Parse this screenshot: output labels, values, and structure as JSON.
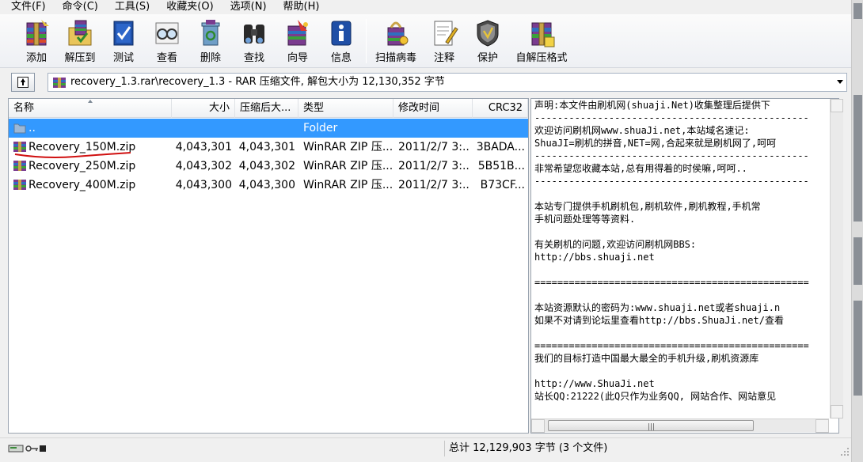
{
  "menu": [
    "文件(F)",
    "命令(C)",
    "工具(S)",
    "收藏夹(O)",
    "选项(N)",
    "帮助(H)"
  ],
  "toolbar": {
    "add": "添加",
    "extract_to": "解压到",
    "test": "测试",
    "view": "查看",
    "delete": "删除",
    "find": "查找",
    "wizard": "向导",
    "info": "信息",
    "virus_scan": "扫描病毒",
    "comment": "注释",
    "protect": "保护",
    "sfx": "自解压格式"
  },
  "address": {
    "path": "recovery_1.3.rar\\recovery_1.3 - RAR 压缩文件, 解包大小为 12,130,352 字节"
  },
  "columns": {
    "name": "名称",
    "size": "大小",
    "packed": "压缩后大...",
    "type": "类型",
    "modified": "修改时间",
    "crc": "CRC32"
  },
  "rows": [
    {
      "name": "..",
      "size": "",
      "packed": "",
      "type": "Folder",
      "modified": "",
      "crc": "",
      "selected": true,
      "icon": "folder-up-icon"
    },
    {
      "name": "Recovery_150M.zip",
      "size": "4,043,301",
      "packed": "4,043,301",
      "type": "WinRAR ZIP 压...",
      "modified": "2011/2/7 3:...",
      "crc": "3BADA...",
      "selected": false,
      "icon": "zip-archive-icon"
    },
    {
      "name": "Recovery_250M.zip",
      "size": "4,043,302",
      "packed": "4,043,302",
      "type": "WinRAR ZIP 压...",
      "modified": "2011/2/7 3:...",
      "crc": "5B51B...",
      "selected": false,
      "icon": "zip-archive-icon"
    },
    {
      "name": "Recovery_400M.zip",
      "size": "4,043,300",
      "packed": "4,043,300",
      "type": "WinRAR ZIP 压...",
      "modified": "2011/2/7 3:...",
      "crc": "B73CF...",
      "selected": false,
      "icon": "zip-archive-icon"
    }
  ],
  "comment_lines": [
    "声明:本文件由刷机网(shuaji.Net)收集整理后提供下",
    "------------------------------------------------",
    "欢迎访问刷机网www.shuaJi.net,本站域名速记:",
    "ShuaJI=刷机的拼音,NET=网,合起来就是刷机网了,呵呵",
    "------------------------------------------------",
    "非常希望您收藏本站,总有用得着的时侯嘛,呵呵..",
    "------------------------------------------------",
    "",
    "本站专门提供手机刷机包,刷机软件,刷机教程,手机常",
    "手机问题处理等等资料.",
    "",
    "有关刷机的问题,欢迎访问刷机网BBS:",
    "http://bbs.shuaji.net",
    "",
    "================================================",
    "",
    "本站资源默认的密码为:www.shuaji.net或者shuaji.n",
    "如果不对请到论坛里查看http://bbs.ShuaJi.net/查看",
    "",
    "================================================",
    "我们的目标打造中国最大最全的手机升级,刷机资源库",
    "",
    "http://www.ShuaJi.net",
    "站长QQ:21222(此Q只作为业务QQ, 网站合作、网站意见"
  ],
  "status": {
    "total": "总计 12,129,903 字节 (3 个文件)"
  },
  "colors": {
    "selection": "#3399ff",
    "annotation_underline": "#d01010"
  }
}
